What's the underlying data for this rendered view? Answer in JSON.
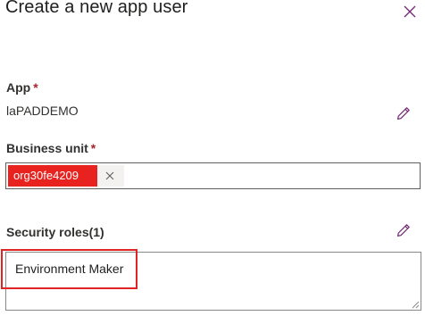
{
  "panel": {
    "title": "Create a new app user",
    "close_icon": "close-icon"
  },
  "app_field": {
    "label": "App",
    "required_mark": "*",
    "value": "laPADDEMO",
    "edit_icon": "pencil-icon"
  },
  "business_unit": {
    "label": "Business unit",
    "required_mark": "*",
    "selected_value": "org30fe4209",
    "remove_icon": "close-icon"
  },
  "security_roles": {
    "label": "Security roles(1)",
    "edit_icon": "pencil-icon",
    "roles": [
      "Environment Maker"
    ]
  },
  "colors": {
    "accent_purple": "#742774",
    "required_red": "#a4262c",
    "redaction_red": "#e8231f",
    "highlight_red": "#e02424"
  }
}
